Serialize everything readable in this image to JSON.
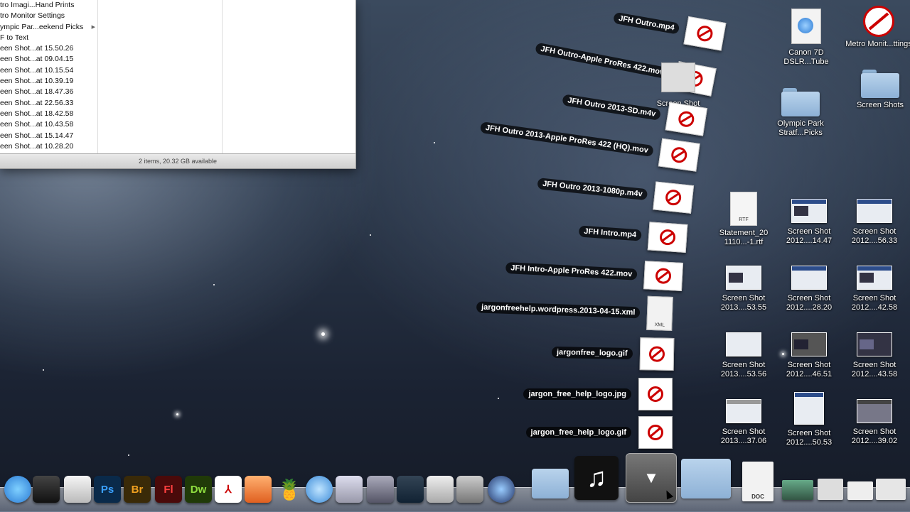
{
  "finder": {
    "rows": [
      "tro Imagi...Hand Prints",
      "tro Monitor Settings",
      "ympic Par...eekend Picks",
      "F to Text",
      "een Shot...at 15.50.26",
      "een Shot...at 09.04.15",
      "een Shot...at 10.15.54",
      "een Shot...at 10.39.19",
      "een Shot...at 18.47.36",
      "een Shot...at 22.56.33",
      "een Shot...at 18.42.58",
      "een Shot...at 10.43.58",
      "een Shot...at 15.14.47",
      "een Shot...at 10.28.20"
    ],
    "status": "2 items, 20.32 GB available"
  },
  "stack": {
    "items": [
      {
        "label": "JFH Outro.mp4",
        "icon": "no-sign-icon"
      },
      {
        "label": "JFH Outro-Apple ProRes 422.mov",
        "icon": "no-sign-icon"
      },
      {
        "label": "JFH Outro 2013-SD.m4v",
        "icon": "no-sign-icon"
      },
      {
        "label": "JFH Outro 2013-Apple ProRes 422 (HQ).mov",
        "icon": "no-sign-icon"
      },
      {
        "label": "JFH Outro 2013-1080p.m4v",
        "icon": "no-sign-icon"
      },
      {
        "label": "JFH Intro.mp4",
        "icon": "no-sign-icon"
      },
      {
        "label": "JFH Intro-Apple ProRes 422.mov",
        "icon": "no-sign-icon"
      },
      {
        "label": "jargonfreehelp.wordpress.2013-04-15.xml",
        "icon": "xml-doc-icon",
        "badge": "XML"
      },
      {
        "label": "jargonfree_logo.gif",
        "icon": "logo-image-icon"
      },
      {
        "label": "jargon_free_help_logo.jpg",
        "icon": "logo-image-icon"
      },
      {
        "label": "jargon_free_help_logo.gif",
        "icon": "logo-image-icon"
      }
    ],
    "partial_label": "Screen Shot"
  },
  "desktop": {
    "canon": "Canon 7D DSLR...Tube",
    "metro": "Metro Monit...ttings",
    "screen_shots_folder": "Screen Shots",
    "olympic": "Olympic Park Stratf...Picks",
    "statement": "Statement_20 1110...-1.rtf",
    "rtf_badge": "RTF",
    "shots": [
      "Screen Shot 2012....14.47",
      "Screen Shot 2012....56.33",
      "Screen Shot 2013....53.55",
      "Screen Shot 2012....28.20",
      "Screen Shot 2012....42.58",
      "Screen Shot 2013....53.56",
      "Screen Shot 2012....46.51",
      "Screen Shot 2012....43.58",
      "Screen Shot 2013....37.06",
      "Screen Shot 2012....50.53",
      "Screen Shot 2012....39.02"
    ]
  },
  "dock": {
    "ps": "Ps",
    "br": "Br",
    "fl": "Fl",
    "dw": "Dw",
    "doc_badge": "DOC"
  }
}
